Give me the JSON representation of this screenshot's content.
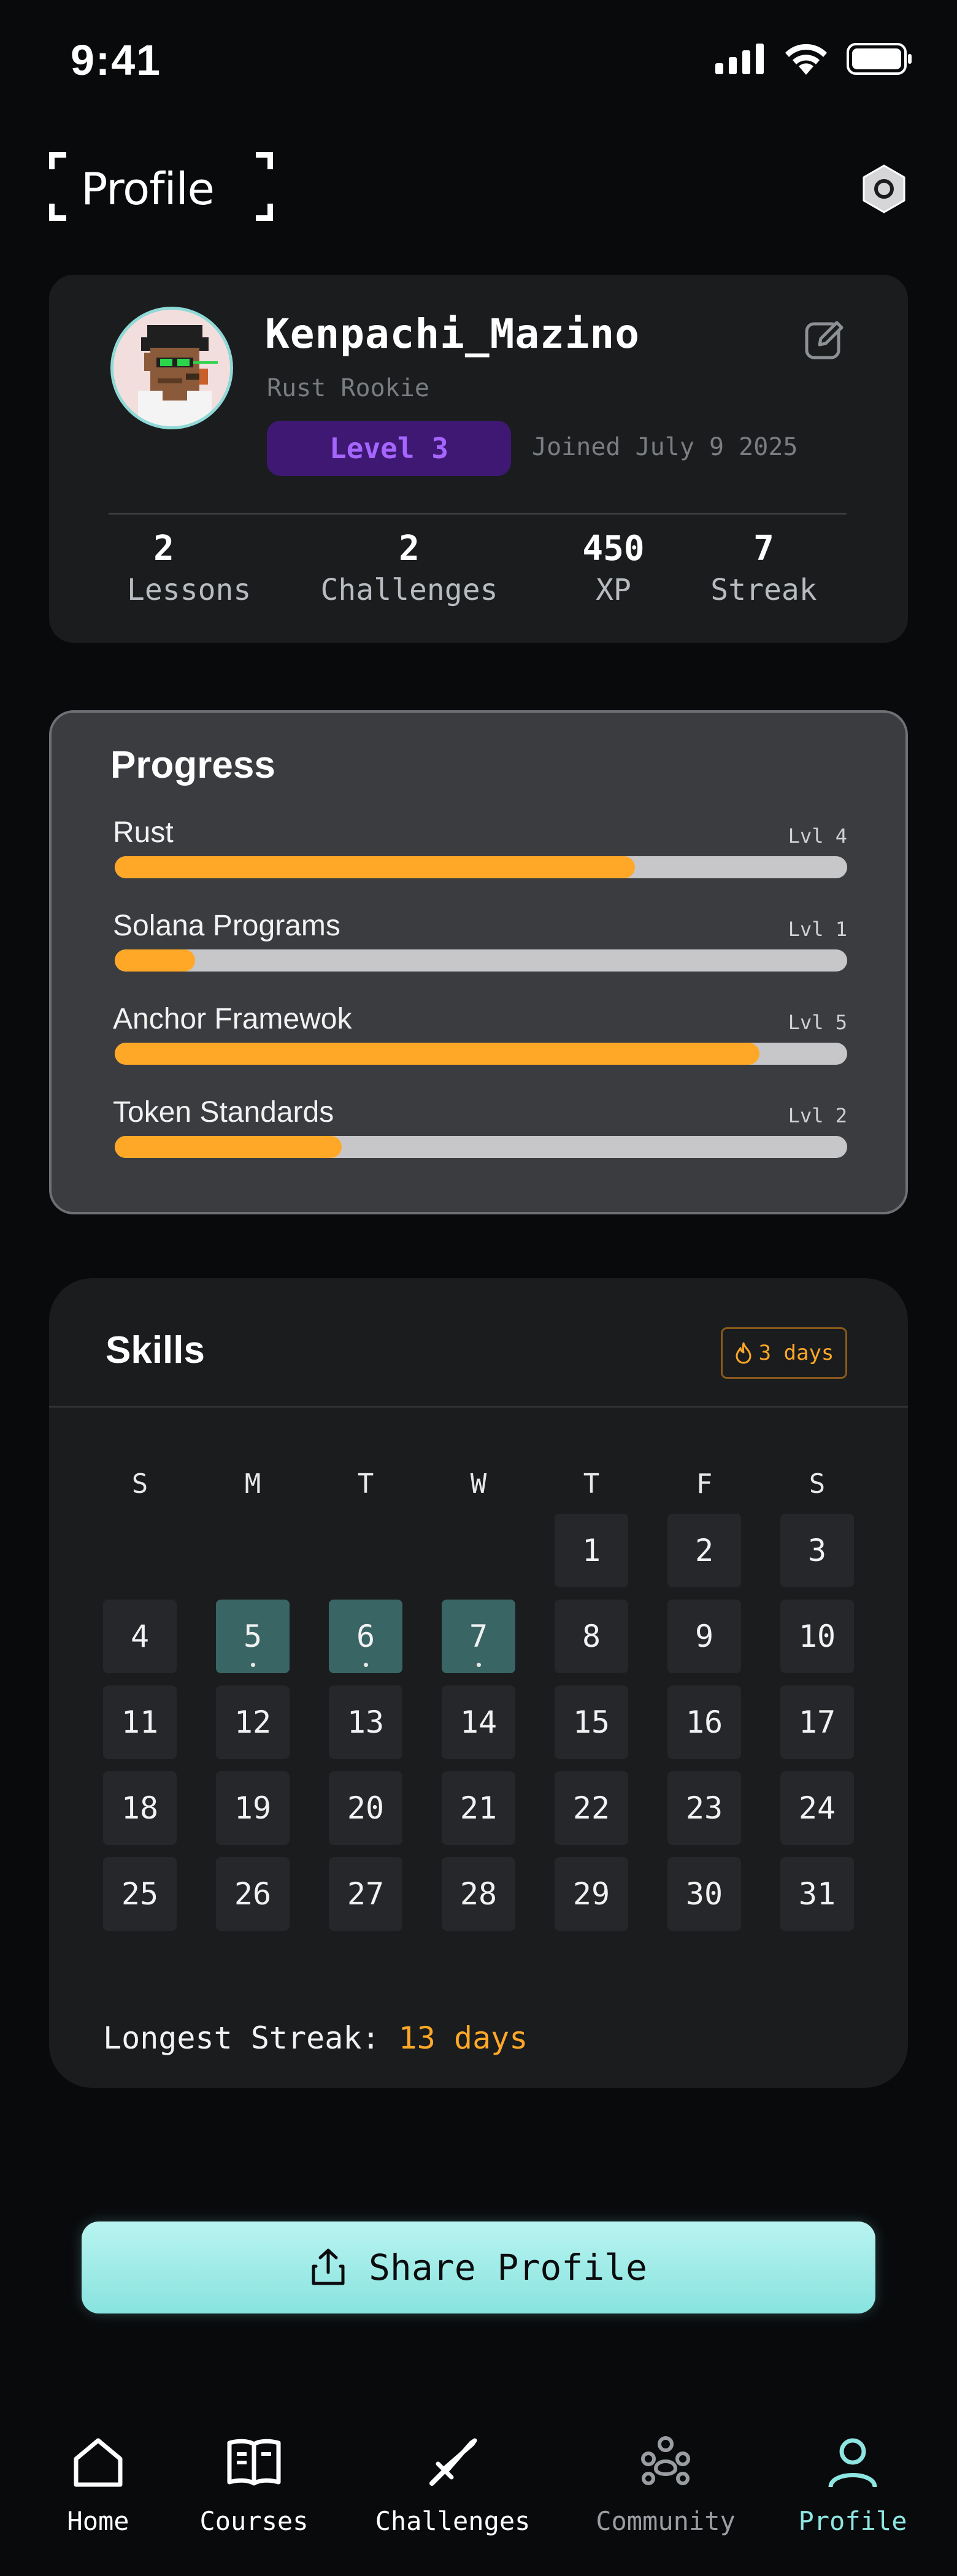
{
  "status_bar": {
    "time": "9:41"
  },
  "header": {
    "title": "Profile"
  },
  "profile": {
    "username": "Kenpachi_Mazino",
    "rank": "Rust Rookie",
    "level": "Level 3",
    "joined": "Joined July 9 2025",
    "stats": [
      {
        "value": "2",
        "label": "Lessons"
      },
      {
        "value": "2",
        "label": "Challenges"
      },
      {
        "value": "450",
        "label": "XP"
      },
      {
        "value": "7",
        "label": "Streak"
      }
    ]
  },
  "progress": {
    "title": "Progress",
    "items": [
      {
        "name": "Rust",
        "level": "Lvl 4",
        "fraction": 0.71
      },
      {
        "name": "Solana Programs",
        "level": "Lvl 1",
        "fraction": 0.11
      },
      {
        "name": "Anchor Framewok",
        "level": "Lvl 5",
        "fraction": 0.88
      },
      {
        "name": "Token Standards",
        "level": "Lvl 2",
        "fraction": 0.31
      }
    ],
    "colors": {
      "fill": "#ffa828",
      "track": "#c7c7c9"
    }
  },
  "skills": {
    "title": "Skills",
    "streak_badge": "3 days",
    "weekdays": [
      "S",
      "M",
      "T",
      "W",
      "T",
      "F",
      "S"
    ],
    "days": [
      "1",
      "2",
      "3",
      "4",
      "5",
      "6",
      "7",
      "8",
      "9",
      "10",
      "11",
      "12",
      "13",
      "14",
      "15",
      "16",
      "17",
      "18",
      "19",
      "20",
      "21",
      "22",
      "23",
      "24",
      "25",
      "26",
      "27",
      "28",
      "29",
      "30",
      "31"
    ],
    "active_days": [
      "5",
      "6",
      "7"
    ],
    "longest_label": "Longest Streak:",
    "longest_value": "13 days"
  },
  "share": {
    "label": "Share Profile"
  },
  "nav": [
    {
      "label": "Home",
      "icon": "home-icon",
      "active": false
    },
    {
      "label": "Courses",
      "icon": "book-icon",
      "active": false
    },
    {
      "label": "Challenges",
      "icon": "sword-icon",
      "active": false
    },
    {
      "label": "Community",
      "icon": "community-icon",
      "active": false
    },
    {
      "label": "Profile",
      "icon": "user-icon",
      "active": true
    }
  ],
  "colors": {
    "accent": "#8ee6e2",
    "orange": "#ffa828",
    "purple": "#a565ff"
  }
}
